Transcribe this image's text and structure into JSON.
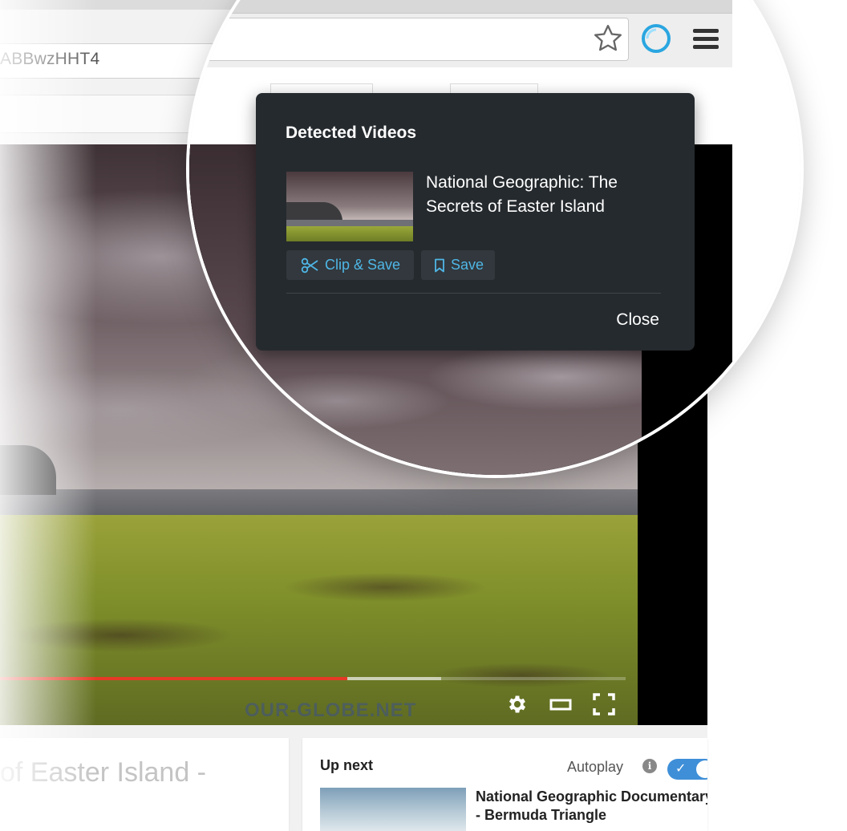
{
  "browser": {
    "url_fragment": "ABBwzHHT4"
  },
  "video": {
    "progress_fraction": 0.555,
    "buffered_fraction": 0.705,
    "watermark": "OUR-GLOBE.NET",
    "controls": {
      "settings_icon": "gear-icon",
      "theater_icon": "theater-mode-icon",
      "fullscreen_icon": "fullscreen-icon"
    }
  },
  "below_video": {
    "title_fragment": "of Easter Island -",
    "up_next_label": "Up next",
    "autoplay_label": "Autoplay",
    "autoplay_on": true,
    "next_video_title": "National Geographic Documentary - Bermuda Triangle"
  },
  "popup": {
    "heading": "Detected Videos",
    "video_title": "National Geographic: The Secrets of Easter Island",
    "clip_save_label": "Clip & Save",
    "save_label": "Save",
    "close_label": "Close",
    "accent_color": "#4fb6e6",
    "background_color": "#252a2e"
  },
  "toolbar_icons": {
    "bookmark": "star-icon",
    "extension": "extension-circle-icon",
    "menu": "hamburger-menu-icon"
  }
}
